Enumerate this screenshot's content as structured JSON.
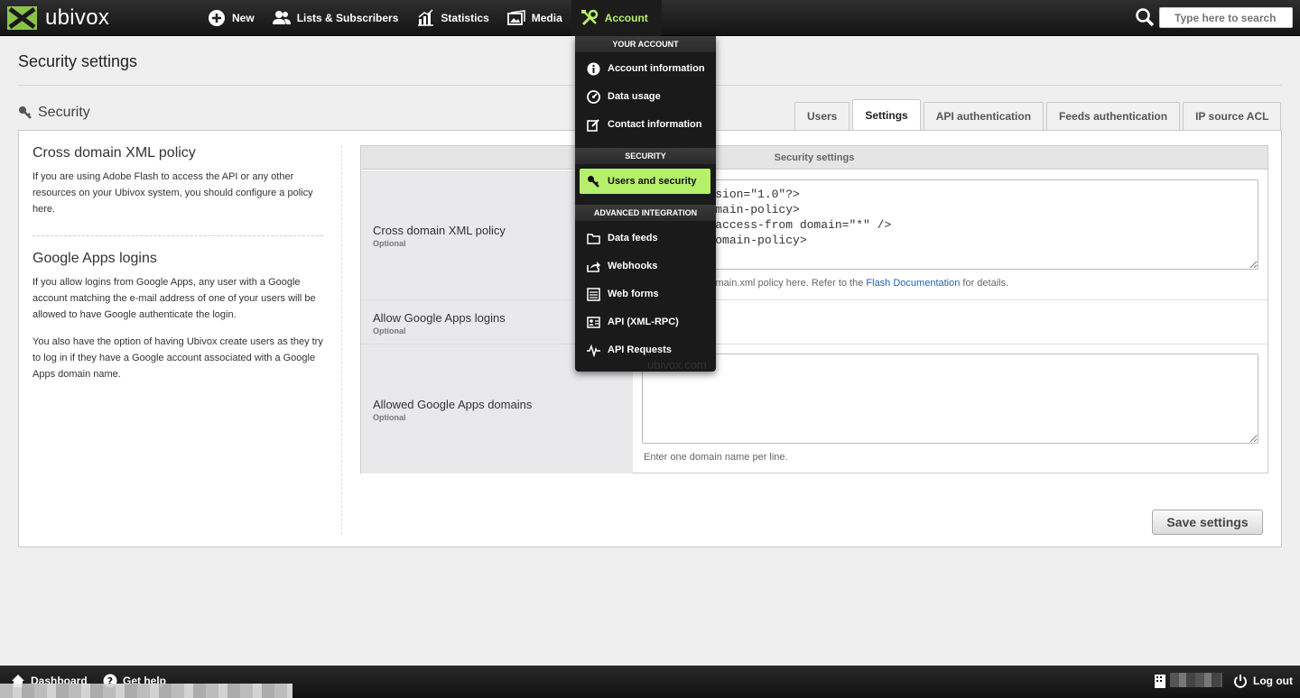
{
  "app": {
    "logo_text": "ubivox"
  },
  "nav": {
    "items": [
      {
        "label": "New",
        "icon": "plus-circle-icon"
      },
      {
        "label": "Lists & Subscribers",
        "icon": "users-icon"
      },
      {
        "label": "Statistics",
        "icon": "bar-chart-icon"
      },
      {
        "label": "Media",
        "icon": "images-icon"
      },
      {
        "label": "Account",
        "icon": "tools-icon"
      }
    ],
    "search_placeholder": "Type here to search"
  },
  "page": {
    "title": "Security settings",
    "section_title": "Security"
  },
  "tabs": [
    "Users",
    "Settings",
    "API authentication",
    "Feeds authentication",
    "IP source ACL"
  ],
  "active_tab": "Settings",
  "left": {
    "h1": "Cross domain XML policy",
    "p1": "If you are using Adobe Flash to access the API or any other resources on your Ubivox system, you should configure a policy here.",
    "h2": "Google Apps logins",
    "p2": "If you allow logins from Google Apps, any user with a Google account matching the e-mail address of one of your users will be allowed to have Google authenticate the login.",
    "p3": "You also have the option of having Ubivox create users as they try to log in if they have a Google account associated with a Google Apps domain name."
  },
  "form": {
    "header": "Security settings",
    "rows": [
      {
        "label": "Cross domain XML policy",
        "optional": "Optional"
      },
      {
        "label": "Allow Google Apps logins",
        "optional": "Optional"
      },
      {
        "label": "Allowed Google Apps domains",
        "optional": "Optional"
      }
    ],
    "xml_value": "<?xml version=\"1.0\"?>\n<cross-domain-policy>\n  <allow-access-from domain=\"*\" />\n</cross-domain-policy>",
    "xml_help_pre": "Setup a crossdomain.xml policy here. Refer to the ",
    "xml_help_link": "Flash Documentation",
    "xml_help_post": " for details.",
    "domains_help": "Enter one domain name per line.",
    "domain_peek": "ubivox.com",
    "save_label": "Save settings"
  },
  "dropdown": {
    "sections": [
      "YOUR ACCOUNT",
      "SECURITY",
      "ADVANCED INTEGRATION"
    ],
    "items": [
      {
        "label": "Account information",
        "icon": "info-icon"
      },
      {
        "label": "Data usage",
        "icon": "gauge-icon"
      },
      {
        "label": "Contact information",
        "icon": "edit-icon"
      },
      {
        "label": "Users and security",
        "icon": "key-icon"
      },
      {
        "label": "Data feeds",
        "icon": "folder-icon"
      },
      {
        "label": "Webhooks",
        "icon": "share-icon"
      },
      {
        "label": "Web forms",
        "icon": "form-icon"
      },
      {
        "label": "API (XML-RPC)",
        "icon": "id-card-icon"
      },
      {
        "label": "API Requests",
        "icon": "pulse-icon"
      }
    ]
  },
  "footer": {
    "dashboard": "Dashboard",
    "help": "Get help",
    "logout": "Log out"
  },
  "colors": {
    "accent": "#b6ef6a",
    "brand": "#8bc34a"
  }
}
